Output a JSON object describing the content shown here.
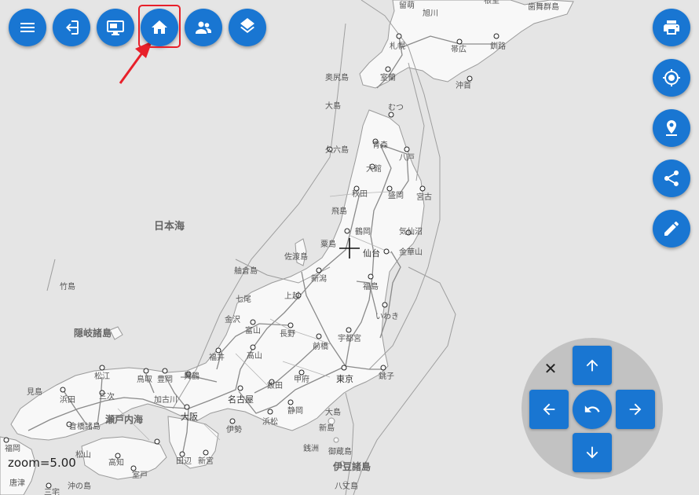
{
  "map": {
    "sea_label": "日本海",
    "zoom_text": "zoom=5.00",
    "colors": {
      "sea": "#e5e5e5",
      "land": "#f8f8f8",
      "coast": "#9a9a9a",
      "road": "#8a8a8a",
      "label": "#555555"
    },
    "places": [
      {
        "name": "留萌"
      },
      {
        "name": "旭川"
      },
      {
        "name": "根室"
      },
      {
        "name": "歯舞群島"
      },
      {
        "name": "札幌"
      },
      {
        "name": "帯広"
      },
      {
        "name": "釧路"
      },
      {
        "name": "室蘭"
      },
      {
        "name": "奥尻島"
      },
      {
        "name": "沖首"
      },
      {
        "name": "大島"
      },
      {
        "name": "むつ"
      },
      {
        "name": "久六島"
      },
      {
        "name": "青森"
      },
      {
        "name": "八戸"
      },
      {
        "name": "大館"
      },
      {
        "name": "秋田"
      },
      {
        "name": "盛岡"
      },
      {
        "name": "宮古"
      },
      {
        "name": "飛島"
      },
      {
        "name": "鶴岡"
      },
      {
        "name": "気仙沼"
      },
      {
        "name": "粟島"
      },
      {
        "name": "仙台"
      },
      {
        "name": "金華山"
      },
      {
        "name": "佐渡島"
      },
      {
        "name": "新潟"
      },
      {
        "name": "福島"
      },
      {
        "name": "舳倉島"
      },
      {
        "name": "上越"
      },
      {
        "name": "七尾"
      },
      {
        "name": "竹島"
      },
      {
        "name": "いわき"
      },
      {
        "name": "金沢"
      },
      {
        "name": "富山"
      },
      {
        "name": "長野"
      },
      {
        "name": "前橋"
      },
      {
        "name": "宇都宮"
      },
      {
        "name": "隠岐諸島"
      },
      {
        "name": "福井"
      },
      {
        "name": "高山"
      },
      {
        "name": "松江"
      },
      {
        "name": "鳥取"
      },
      {
        "name": "豊岡"
      },
      {
        "name": "舞鶴"
      },
      {
        "name": "甲府"
      },
      {
        "name": "東京"
      },
      {
        "name": "銚子"
      },
      {
        "name": "見島"
      },
      {
        "name": "浜田"
      },
      {
        "name": "三次"
      },
      {
        "name": "加古川"
      },
      {
        "name": "名古屋"
      },
      {
        "name": "飯田"
      },
      {
        "name": "静岡"
      },
      {
        "name": "瀬戸内海"
      },
      {
        "name": "大阪"
      },
      {
        "name": "浜松"
      },
      {
        "name": "大島"
      },
      {
        "name": "倉橋諸島"
      },
      {
        "name": "伊勢"
      },
      {
        "name": "新島"
      },
      {
        "name": "銭洲"
      },
      {
        "name": "御蔵島"
      },
      {
        "name": "福岡"
      },
      {
        "name": "松山"
      },
      {
        "name": "高知"
      },
      {
        "name": "新宮"
      },
      {
        "name": "田辺"
      },
      {
        "name": "室戸"
      },
      {
        "name": "伊豆諸島"
      },
      {
        "name": "唐津"
      },
      {
        "name": "沖の島"
      },
      {
        "name": "八丈島"
      },
      {
        "name": "三宅"
      }
    ]
  },
  "toolbar": {
    "buttons": [
      {
        "name": "menu",
        "icon": "menu-icon"
      },
      {
        "name": "login",
        "icon": "login-icon"
      },
      {
        "name": "display",
        "icon": "monitor-icon"
      },
      {
        "name": "home",
        "icon": "home-icon"
      },
      {
        "name": "users",
        "icon": "people-icon"
      },
      {
        "name": "layers",
        "icon": "layers-icon"
      }
    ]
  },
  "right_tools": [
    {
      "name": "print",
      "icon": "printer-icon"
    },
    {
      "name": "locate",
      "icon": "crosshair-icon"
    },
    {
      "name": "place",
      "icon": "map-pin-icon"
    },
    {
      "name": "share",
      "icon": "share-icon"
    },
    {
      "name": "edit",
      "icon": "pencil-icon"
    }
  ],
  "nav_pad": {
    "close_glyph": "✕",
    "icons": [
      "arrow-up-icon",
      "arrow-left-icon",
      "undo-icon",
      "arrow-right-icon",
      "arrow-down-icon"
    ]
  }
}
